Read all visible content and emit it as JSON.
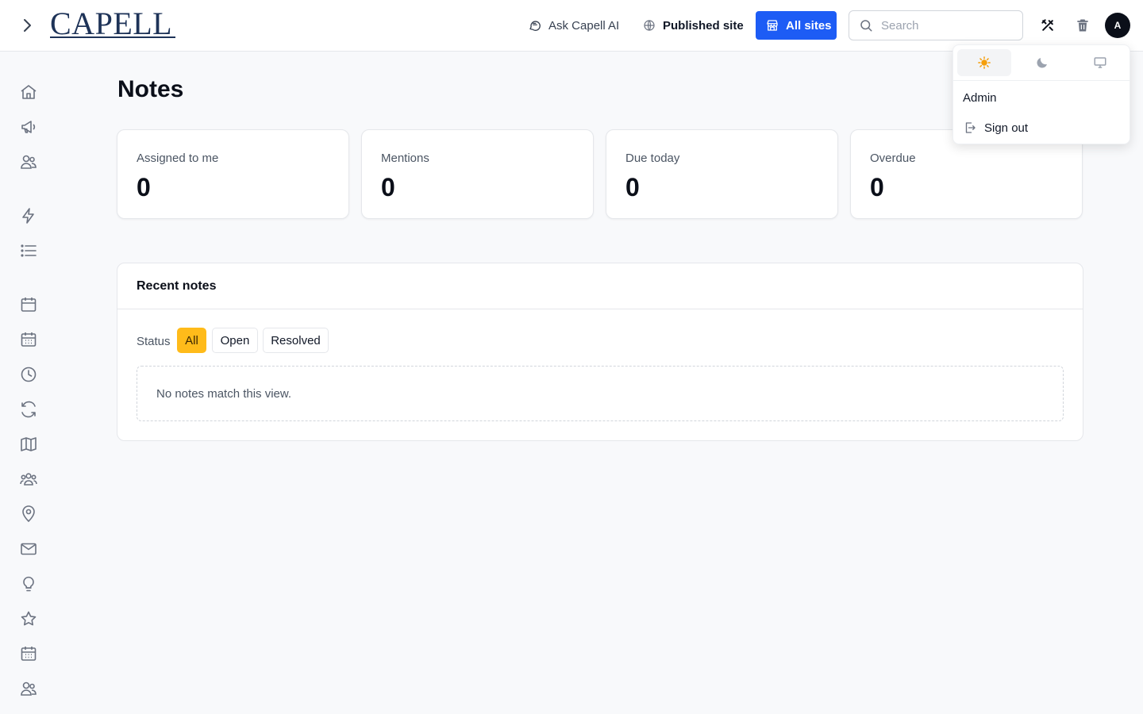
{
  "header": {
    "logo_text": "CAPELL",
    "ask_ai_label": "Ask Capell AI",
    "published_site_label": "Published site",
    "all_sites_label": "All sites",
    "search_placeholder": "Search",
    "search_value": "",
    "avatar_initial": "A"
  },
  "sidebar": {
    "icons": [
      "home-icon",
      "megaphone-icon",
      "users-icon",
      "lightning-icon",
      "list-icon",
      "calendar-icon",
      "calendar-grid-icon",
      "clock-icon",
      "refresh-icon",
      "map-icon",
      "group-icon",
      "map-pin-icon",
      "mail-icon",
      "lightbulb-icon",
      "star-icon",
      "calendar-grid-icon",
      "users-icon"
    ]
  },
  "page": {
    "title": "Notes",
    "stats": [
      {
        "label": "Assigned to me",
        "value": "0"
      },
      {
        "label": "Mentions",
        "value": "0"
      },
      {
        "label": "Due today",
        "value": "0"
      },
      {
        "label": "Overdue",
        "value": "0"
      }
    ],
    "recent": {
      "title": "Recent notes",
      "status_label": "Status",
      "filters": [
        "All",
        "Open",
        "Resolved"
      ],
      "active_filter": "All",
      "empty_text": "No notes match this view."
    }
  },
  "dropdown": {
    "themes": [
      "sun-icon",
      "moon-icon",
      "monitor-icon"
    ],
    "active_theme": "light",
    "user_name": "Admin",
    "sign_out_label": "Sign out"
  },
  "colors": {
    "accent_blue": "#1d5cf5",
    "accent_yellow": "#ffbb1a",
    "logo_navy": "#1e3358"
  }
}
